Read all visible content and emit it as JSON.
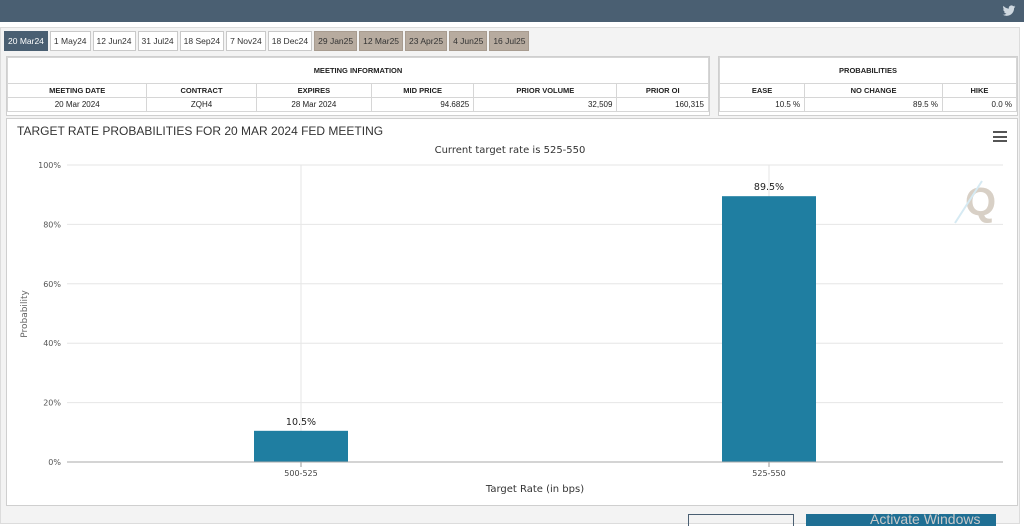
{
  "tabs": [
    {
      "label": "20 Mar24",
      "state": "active"
    },
    {
      "label": "1 May24",
      "state": "normal"
    },
    {
      "label": "12 Jun24",
      "state": "normal"
    },
    {
      "label": "31 Jul24",
      "state": "normal"
    },
    {
      "label": "18 Sep24",
      "state": "normal"
    },
    {
      "label": "7 Nov24",
      "state": "normal"
    },
    {
      "label": "18 Dec24",
      "state": "normal"
    },
    {
      "label": "29 Jan25",
      "state": "future"
    },
    {
      "label": "12 Mar25",
      "state": "future"
    },
    {
      "label": "23 Apr25",
      "state": "future"
    },
    {
      "label": "4 Jun25",
      "state": "future"
    },
    {
      "label": "16 Jul25",
      "state": "future"
    }
  ],
  "meeting_info": {
    "title": "MEETING INFORMATION",
    "headers": [
      "MEETING DATE",
      "CONTRACT",
      "EXPIRES",
      "MID PRICE",
      "PRIOR VOLUME",
      "PRIOR OI"
    ],
    "row": [
      "20 Mar 2024",
      "ZQH4",
      "28 Mar 2024",
      "94.6825",
      "32,509",
      "160,315"
    ]
  },
  "probabilities": {
    "title": "PROBABILITIES",
    "headers": [
      "EASE",
      "NO CHANGE",
      "HIKE"
    ],
    "row": [
      "10.5 %",
      "89.5 %",
      "0.0 %"
    ]
  },
  "chart_title": "TARGET RATE PROBABILITIES FOR 20 MAR 2024 FED MEETING",
  "watermark_text": "Activate Windows",
  "colors": {
    "bar": "#1f7ea1",
    "header": "#4a5f72",
    "future_tab": "#b7ab9f"
  },
  "chart_data": {
    "type": "bar",
    "title": "",
    "subtitle": "Current target rate is 525-550",
    "xlabel": "Target Rate (in bps)",
    "ylabel": "Probability",
    "categories": [
      "500-525",
      "525-550"
    ],
    "values": [
      10.5,
      89.5
    ],
    "data_labels": [
      "10.5%",
      "89.5%"
    ],
    "ylim": [
      0,
      100
    ],
    "yticks": [
      0,
      20,
      40,
      60,
      80,
      100
    ],
    "ytick_labels": [
      "0%",
      "20%",
      "40%",
      "60%",
      "80%",
      "100%"
    ],
    "grid": true,
    "legend": "none"
  }
}
